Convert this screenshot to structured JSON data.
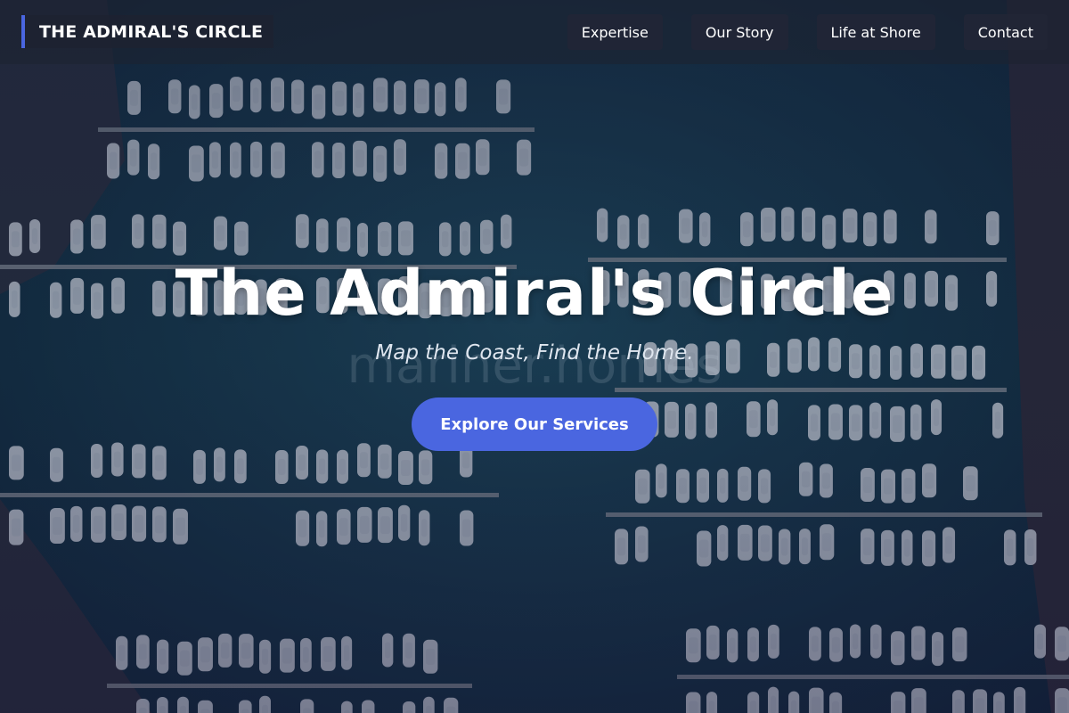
{
  "nav": {
    "brand": "THE ADMIRAL'S CIRCLE",
    "links": [
      {
        "label": "Expertise"
      },
      {
        "label": "Our Story"
      },
      {
        "label": "Life at Shore"
      },
      {
        "label": "Contact"
      }
    ]
  },
  "hero": {
    "title": "The Admiral's Circle",
    "subtitle": "Map the Coast, Find the Home.",
    "watermark": "mariner.homes",
    "cta_label": "Explore Our Services",
    "background_image": "aerial-marina-photo"
  },
  "colors": {
    "accent": "#4a66e0",
    "water": "#0f2c3d",
    "nav_bg": "#1e2230"
  }
}
